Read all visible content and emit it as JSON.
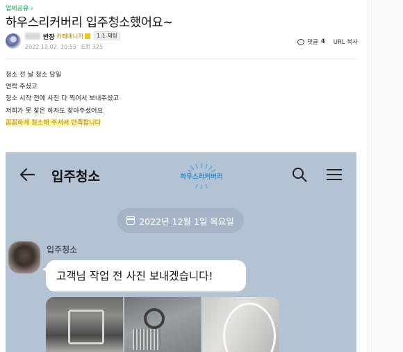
{
  "post": {
    "category": "업체공유",
    "title": "하우스리커버리 입주청소했어요~",
    "author": {
      "name": "반장",
      "badge": "카페매니저",
      "chat_badge": "1:1 채팅"
    },
    "date": "2022.12.02. 10:55",
    "views_label": "조회 325",
    "comments_label": "댓글",
    "comments_count": "4",
    "url_copy_label": "URL 복사",
    "lines": [
      "청소 전 날 청소 당일",
      "연락 주셨고",
      "청소 시작 전에 사진 다 찍어서 보내주셨고",
      "저희가 못 찾은 하자도 찾아주셨어요",
      "꼼꼼하게 청소해 주셔서 만족합니다"
    ]
  },
  "screenshot": {
    "title": "입주청소",
    "logo_text": "하우스리커버리",
    "date_label": "2022년 12월 1일 목요일",
    "sender_name": "입주청소",
    "message": "고객님 작업 전 사진 보내겠습니다!"
  },
  "colors": {
    "category_green": "#03a94b",
    "highlight": "#fff8a8",
    "chat_bg": "#b4c3d4"
  },
  "icons": [
    "chevron-right-icon",
    "comment-icon",
    "back-arrow-icon",
    "search-icon",
    "menu-icon",
    "calendar-icon"
  ]
}
